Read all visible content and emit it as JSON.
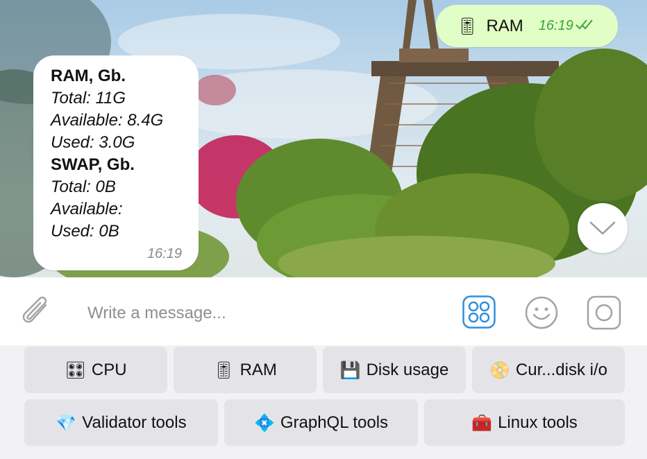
{
  "chat": {
    "outgoing": {
      "emoji": "🎚",
      "text": "RAM",
      "time": "16:19",
      "status_icon": "double-check-icon"
    },
    "incoming": {
      "lines": [
        {
          "text": "RAM, Gb.",
          "style": "bold"
        },
        {
          "text": "Total: 11G",
          "style": "italic"
        },
        {
          "text": "Available: 8.4G",
          "style": "italic"
        },
        {
          "text": "Used: 3.0G",
          "style": "italic"
        },
        {
          "text": "SWAP, Gb.",
          "style": "bold"
        },
        {
          "text": "Total: 0B",
          "style": "italic"
        },
        {
          "text": "Available:",
          "style": "italic"
        },
        {
          "text": "Used: 0B",
          "style": "italic"
        }
      ],
      "time": "16:19"
    },
    "scroll_down_icon": "chevron-down-icon"
  },
  "input_bar": {
    "placeholder": "Write a message...",
    "attach_icon": "paperclip-icon",
    "keyboard_icon": "bot-keyboard-icon",
    "emoji_icon": "smiley-icon",
    "camera_icon": "camera-icon"
  },
  "keyboard": {
    "rows": [
      [
        {
          "icon": "🎛",
          "label": "CPU"
        },
        {
          "icon": "🎚",
          "label": "RAM"
        },
        {
          "icon": "💾",
          "label": "Disk usage"
        },
        {
          "icon": "📀",
          "label": "Cur...disk i/o"
        }
      ],
      [
        {
          "icon": "💎",
          "label": "Validator tools"
        },
        {
          "icon": "💠",
          "label": "GraphQL tools"
        },
        {
          "icon": "🧰",
          "label": "Linux tools"
        }
      ]
    ]
  },
  "colors": {
    "outgoing_bubble": "#e1fec6",
    "outgoing_time": "#3fa43a",
    "accent": "#2f8fdd",
    "key_bg": "#e4e4e8"
  }
}
